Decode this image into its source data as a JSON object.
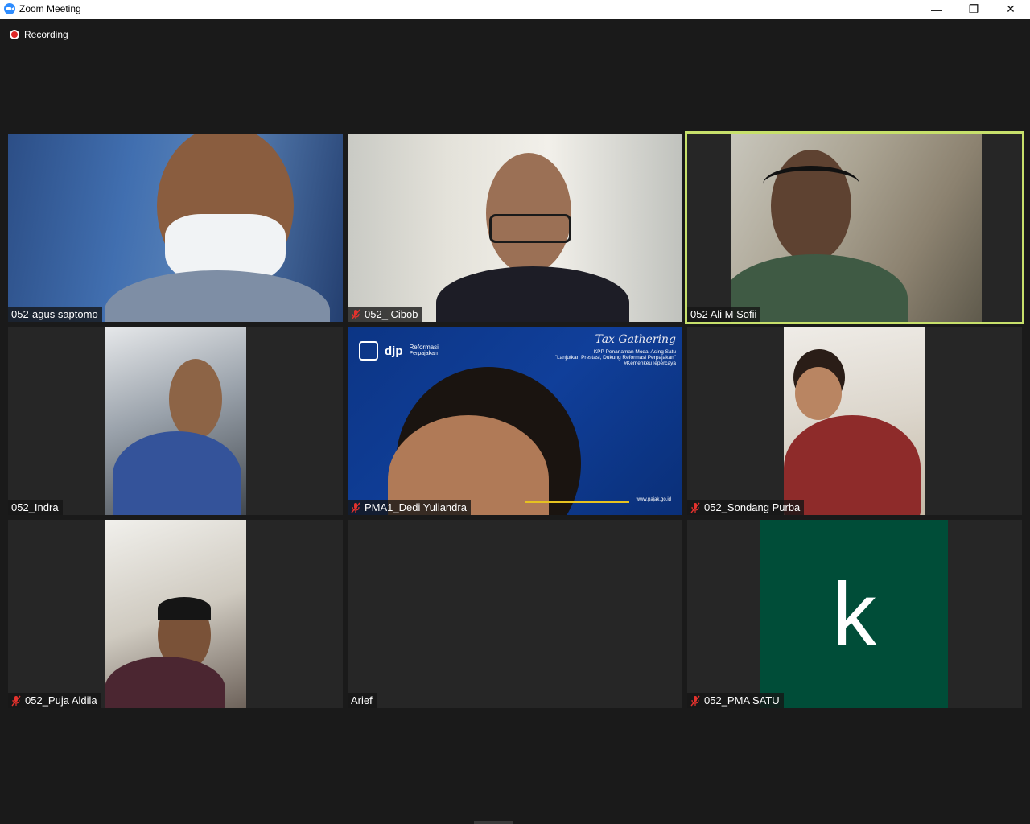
{
  "window": {
    "title": "Zoom Meeting",
    "minimize_glyph": "—",
    "restore_glyph": "❐",
    "close_glyph": "✕"
  },
  "recording": {
    "label": "Recording",
    "color": "#e02828"
  },
  "accent": {
    "active_speaker_border": "#c7e06b",
    "mute_icon_color": "#e5322d"
  },
  "participants": [
    {
      "name": "052-agus saptomo",
      "muted": false,
      "active": false
    },
    {
      "name": "052_ Cibob",
      "muted": true,
      "active": false
    },
    {
      "name": "052 Ali M Sofii",
      "muted": false,
      "active": true
    },
    {
      "name": "052_Indra",
      "muted": false,
      "active": false
    },
    {
      "name": "PMA1_Dedi Yuliandra",
      "muted": true,
      "active": false
    },
    {
      "name": "052_Sondang Purba",
      "muted": true,
      "active": false
    },
    {
      "name": "052_Puja Aldila",
      "muted": true,
      "active": false
    },
    {
      "name": "Arief",
      "muted": false,
      "active": false
    },
    {
      "name": "052_PMA SATU",
      "muted": true,
      "active": false,
      "avatar_letter": "k",
      "avatar_color": "#004d38"
    }
  ],
  "banner": {
    "brand": "djp",
    "reform": "Reformasi",
    "reform_sub": "Perpajakan",
    "event": "Tax Gathering",
    "office": "KPP Penanaman Modal Asing Satu",
    "tagline": "\"Lanjutkan Prestasi, Dukung Reformasi Perpajakan\"",
    "hashtag": "#KemenkeuTepercaya",
    "url": "www.pajak.go.id"
  }
}
